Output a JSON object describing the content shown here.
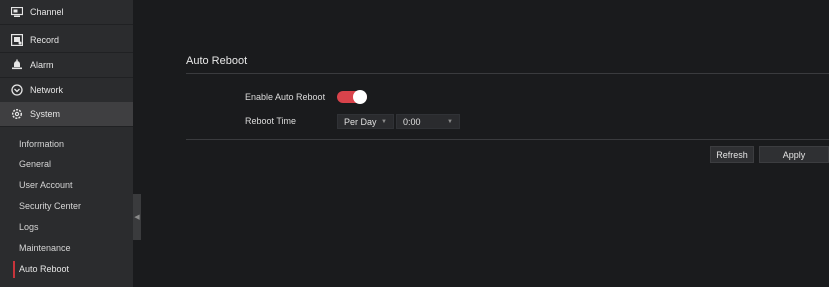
{
  "sidebar": {
    "nav": [
      {
        "label": "Channel",
        "icon": "camera-monitor-icon"
      },
      {
        "label": "Record",
        "icon": "record-icon"
      },
      {
        "label": "Alarm",
        "icon": "alarm-icon"
      },
      {
        "label": "Network",
        "icon": "network-icon"
      },
      {
        "label": "System",
        "icon": "gear-icon",
        "active": true
      }
    ],
    "sub_items": [
      {
        "label": "Information"
      },
      {
        "label": "General"
      },
      {
        "label": "User Account"
      },
      {
        "label": "Security Center"
      },
      {
        "label": "Logs"
      },
      {
        "label": "Maintenance"
      },
      {
        "label": "Auto Reboot",
        "active": true
      }
    ],
    "collapse_glyph": "◀"
  },
  "main": {
    "section_title": "Auto Reboot",
    "enable_label": "Enable Auto Reboot",
    "enable_value": true,
    "reboot_time_label": "Reboot Time",
    "frequency_value": "Per Day",
    "time_value": "0:00",
    "caret_glyph": "▼",
    "refresh_label": "Refresh",
    "apply_label": "Apply"
  },
  "colors": {
    "accent": "#d9434b",
    "background": "#1a1b1d",
    "sidebar": "#2b2c2e",
    "sidebar_active": "#3f3f41"
  }
}
